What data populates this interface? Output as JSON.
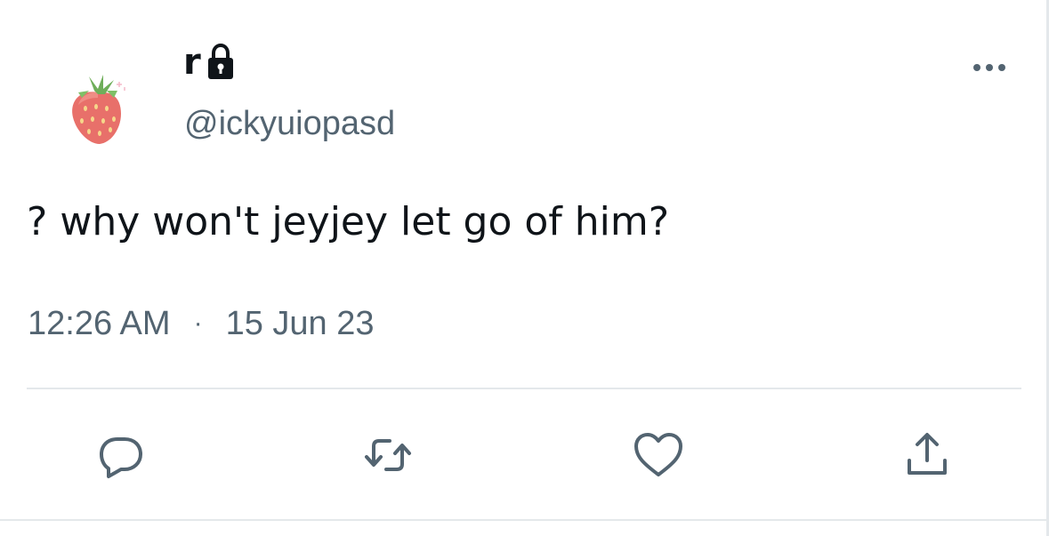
{
  "tweet": {
    "display_name": "r",
    "handle": "@ickyuiopasd",
    "text": "? why won't jeyjey let go of him?",
    "time": "12:26 AM",
    "separator": "·",
    "date": "15 Jun 23",
    "avatar_icon": "strawberry-avatar",
    "protected_icon": "lock-icon",
    "more_icon": "more-options-icon"
  },
  "actions": {
    "reply_icon": "reply-icon",
    "retweet_icon": "retweet-icon",
    "like_icon": "heart-icon",
    "share_icon": "share-icon"
  },
  "colors": {
    "text": "#0f1419",
    "secondary_text": "#536471",
    "divider": "#e4e8eb",
    "strawberry": "#e8706a",
    "leaf": "#6fae5a"
  }
}
